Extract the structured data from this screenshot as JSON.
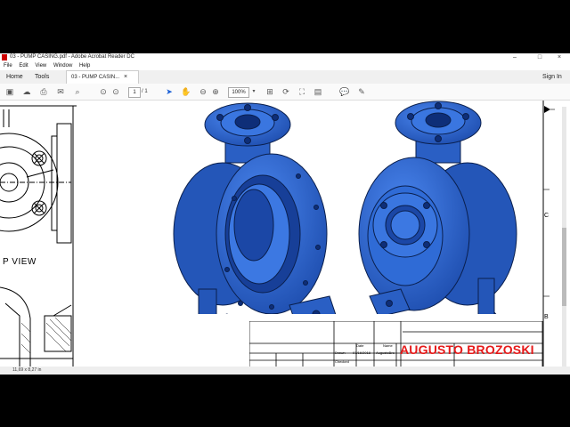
{
  "window": {
    "title": "03 - PUMP CASING.pdf - Adobe Acrobat Reader DC",
    "minimize": "–",
    "maximize": "□",
    "close": "×"
  },
  "menu": [
    "File",
    "Edit",
    "View",
    "Window",
    "Help"
  ],
  "tabs": {
    "home": "Home",
    "tools": "Tools",
    "document": "03 - PUMP CASIN...",
    "document_close": "×",
    "sign_in": "Sign In"
  },
  "toolbar": {
    "page_current": "1",
    "page_total": "/ 1",
    "zoom": "100%"
  },
  "drawing": {
    "view_label": "P VIEW",
    "zone_c": "C",
    "zone_b": "B"
  },
  "titleblock": {
    "col_date": "Date",
    "col_name": "Name",
    "row_drawn": "Drawn",
    "row_checked": "Checked",
    "drawn_date": "07/16/2018",
    "drawn_name": "AugustoBro"
  },
  "watermark": "AUGUSTO BROZOSKI",
  "status": {
    "page_size": "11,69 x 8,27 in"
  },
  "colors": {
    "part_blue": "#2f6bd6",
    "part_dark": "#123a8a",
    "watermark_red": "#e51919"
  }
}
